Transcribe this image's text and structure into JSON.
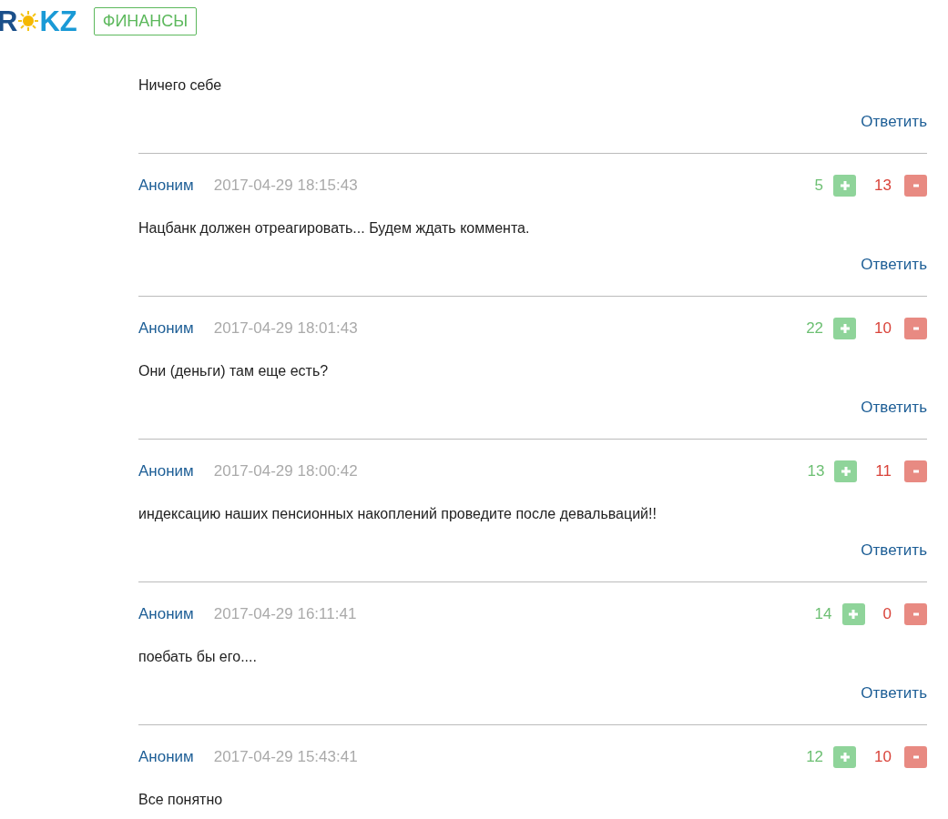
{
  "logo": {
    "left": "R",
    "right": "KZ"
  },
  "section_tag": "ФИНАНСЫ",
  "comments": [
    {
      "text": "Ничего себе",
      "reply": "Ответить"
    },
    {
      "author": "Аноним",
      "time": "2017-04-29 18:15:43",
      "likes": "5",
      "dislikes": "13",
      "text": "Нацбанк должен отреагировать... Будем ждать коммента.",
      "reply": "Ответить"
    },
    {
      "author": "Аноним",
      "time": "2017-04-29 18:01:43",
      "likes": "22",
      "dislikes": "10",
      "text": "Они (деньги) там еще есть?",
      "reply": "Ответить"
    },
    {
      "author": "Аноним",
      "time": "2017-04-29 18:00:42",
      "likes": "13",
      "dislikes": "11",
      "text": "индексацию наших пенсионных накоплений проведите после девальваций!!",
      "reply": "Ответить"
    },
    {
      "author": "Аноним",
      "time": "2017-04-29 16:11:41",
      "likes": "14",
      "dislikes": "0",
      "text": "поебать бы его....",
      "reply": "Ответить"
    },
    {
      "author": "Аноним",
      "time": "2017-04-29 15:43:41",
      "likes": "12",
      "dislikes": "10",
      "text": "Все понятно"
    }
  ]
}
